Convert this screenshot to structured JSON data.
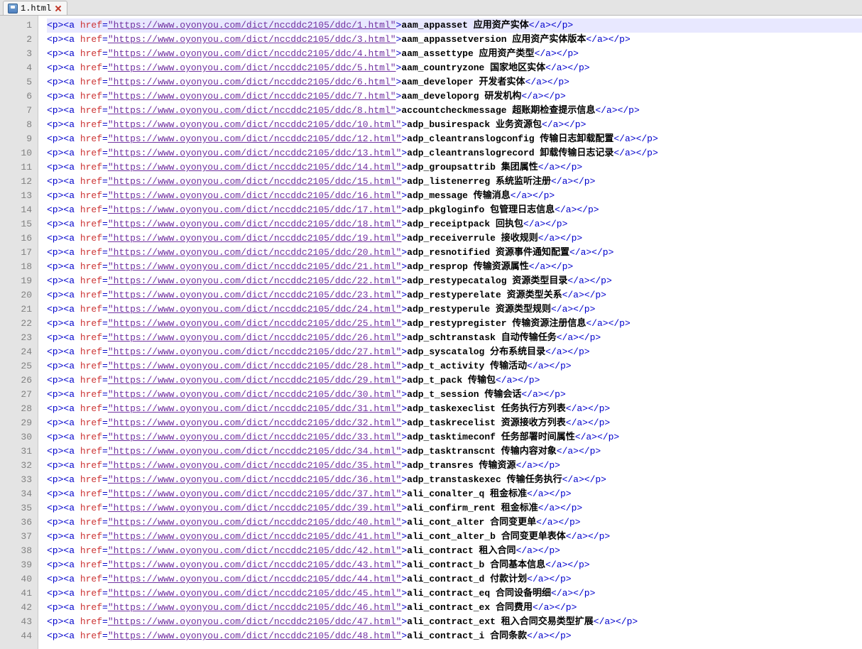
{
  "tab": {
    "filename": "1.html"
  },
  "url_prefix": "https://www.oyonyou.com/dict/nccddc2105/ddc/",
  "rows": [
    {
      "n": 1,
      "id": "1",
      "label": "aam_appasset 应用资产实体"
    },
    {
      "n": 2,
      "id": "3",
      "label": "aam_appassetversion 应用资产实体版本"
    },
    {
      "n": 3,
      "id": "4",
      "label": "aam_assettype 应用资产类型"
    },
    {
      "n": 4,
      "id": "5",
      "label": "aam_countryzone 国家地区实体"
    },
    {
      "n": 5,
      "id": "6",
      "label": "aam_developer 开发者实体"
    },
    {
      "n": 6,
      "id": "7",
      "label": "aam_developorg 研发机构"
    },
    {
      "n": 7,
      "id": "8",
      "label": "accountcheckmessage 超账期检查提示信息"
    },
    {
      "n": 8,
      "id": "10",
      "label": "adp_busirespack 业务资源包"
    },
    {
      "n": 9,
      "id": "12",
      "label": "adp_cleantranslogconfig 传输日志卸载配置"
    },
    {
      "n": 10,
      "id": "13",
      "label": "adp_cleantranslogrecord 卸载传输日志记录"
    },
    {
      "n": 11,
      "id": "14",
      "label": "adp_groupsattrib 集团属性"
    },
    {
      "n": 12,
      "id": "15",
      "label": "adp_listenerreg 系统监听注册"
    },
    {
      "n": 13,
      "id": "16",
      "label": "adp_message 传输消息"
    },
    {
      "n": 14,
      "id": "17",
      "label": "adp_pkgloginfo 包管理日志信息"
    },
    {
      "n": 15,
      "id": "18",
      "label": "adp_receiptpack 回执包"
    },
    {
      "n": 16,
      "id": "19",
      "label": "adp_receiverrule 接收规则"
    },
    {
      "n": 17,
      "id": "20",
      "label": "adp_resnotified 资源事件通知配置"
    },
    {
      "n": 18,
      "id": "21",
      "label": "adp_resprop 传输资源属性"
    },
    {
      "n": 19,
      "id": "22",
      "label": "adp_restypecatalog 资源类型目录"
    },
    {
      "n": 20,
      "id": "23",
      "label": "adp_restyperelate 资源类型关系"
    },
    {
      "n": 21,
      "id": "24",
      "label": "adp_restyperule 资源类型规则"
    },
    {
      "n": 22,
      "id": "25",
      "label": "adp_restypregister 传输资源注册信息"
    },
    {
      "n": 23,
      "id": "26",
      "label": "adp_schtranstask 自动传输任务"
    },
    {
      "n": 24,
      "id": "27",
      "label": "adp_syscatalog 分布系统目录"
    },
    {
      "n": 25,
      "id": "28",
      "label": "adp_t_activity 传输活动"
    },
    {
      "n": 26,
      "id": "29",
      "label": "adp_t_pack 传输包"
    },
    {
      "n": 27,
      "id": "30",
      "label": "adp_t_session 传输会话"
    },
    {
      "n": 28,
      "id": "31",
      "label": "adp_taskexeclist 任务执行方列表"
    },
    {
      "n": 29,
      "id": "32",
      "label": "adp_taskrecelist 资源接收方列表"
    },
    {
      "n": 30,
      "id": "33",
      "label": "adp_tasktimeconf 任务部署时间属性"
    },
    {
      "n": 31,
      "id": "34",
      "label": "adp_tasktranscnt 传输内容对象"
    },
    {
      "n": 32,
      "id": "35",
      "label": "adp_transres 传输资源"
    },
    {
      "n": 33,
      "id": "36",
      "label": "adp_transtaskexec 传输任务执行"
    },
    {
      "n": 34,
      "id": "37",
      "label": "ali_conalter_q 租金标准"
    },
    {
      "n": 35,
      "id": "39",
      "label": "ali_confirm_rent 租金标准"
    },
    {
      "n": 36,
      "id": "40",
      "label": "ali_cont_alter 合同变更单"
    },
    {
      "n": 37,
      "id": "41",
      "label": "ali_cont_alter_b 合同变更单表体"
    },
    {
      "n": 38,
      "id": "42",
      "label": "ali_contract 租入合同"
    },
    {
      "n": 39,
      "id": "43",
      "label": "ali_contract_b 合同基本信息"
    },
    {
      "n": 40,
      "id": "44",
      "label": "ali_contract_d 付款计划"
    },
    {
      "n": 41,
      "id": "45",
      "label": "ali_contract_eq 合同设备明细"
    },
    {
      "n": 42,
      "id": "46",
      "label": "ali_contract_ex 合同费用"
    },
    {
      "n": 43,
      "id": "47",
      "label": "ali_contract_ext 租入合同交易类型扩展"
    },
    {
      "n": 44,
      "id": "48",
      "label": "ali_contract_i 合同条款"
    }
  ]
}
